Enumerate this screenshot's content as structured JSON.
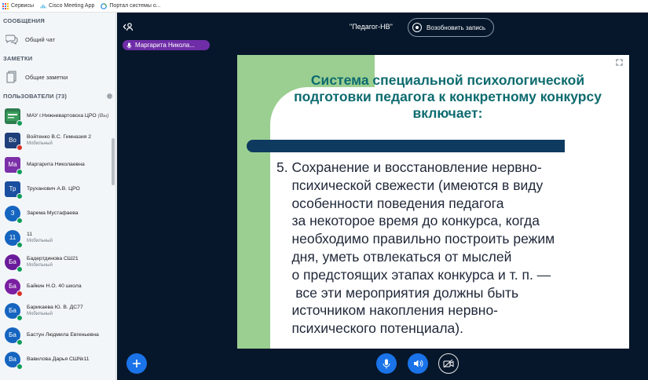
{
  "bookmarks": [
    {
      "label": "Сервисы",
      "icon": "apps-icon"
    },
    {
      "label": "Cisco Meeting App",
      "icon": "cisco-icon"
    },
    {
      "label": "Портал системы о...",
      "icon": "portal-icon"
    }
  ],
  "sidebar": {
    "messages_title": "СООБЩЕНИЯ",
    "public_chat": "Общий чат",
    "notes_title": "ЗАМЕТКИ",
    "shared_notes": "Общие заметки",
    "users_title": "ПОЛЬЗОВАТЕЛИ (73)",
    "users": [
      {
        "initials": "",
        "name": "МАУ г.Нижневартовска ЦРО",
        "you": "(Вы)",
        "sub": "",
        "color": "#2e7d4f",
        "mic": "green",
        "logo": true
      },
      {
        "initials": "Во",
        "name": "Войтенко В.С. Гимназия 2",
        "sub": "Мобильный",
        "color": "#1e3f7a",
        "mic": "red",
        "round": false
      },
      {
        "initials": "Ма",
        "name": "Маргарита Николаевна",
        "sub": "",
        "color": "#7b2fa8",
        "mic": "green",
        "round": false
      },
      {
        "initials": "Тр",
        "name": "Труханович А.В. ЦРО",
        "sub": "",
        "color": "#1a4fa0",
        "mic": "green",
        "round": false
      },
      {
        "initials": "З",
        "name": "Зарема Мустафаева",
        "sub": "",
        "color": "#1565c0",
        "mic": "green",
        "round": true
      },
      {
        "initials": "11",
        "name": "11",
        "sub": "Мобильный",
        "color": "#1565c0",
        "mic": "green",
        "round": true
      },
      {
        "initials": "Ба",
        "name": "Бадертдинова СШ21",
        "sub": "Мобильный",
        "color": "#6a1b9a",
        "mic": "green",
        "round": true
      },
      {
        "initials": "Ба",
        "name": "Байкин Н.О. 40 школа",
        "sub": "",
        "color": "#7b1fa2",
        "mic": "red",
        "round": true
      },
      {
        "initials": "Ба",
        "name": "Барикаева Ю. В. ДС77",
        "sub": "Мобильный",
        "color": "#1565c0",
        "mic": "green",
        "round": true
      },
      {
        "initials": "Ба",
        "name": "Бастун Людмила Евгеньевна",
        "sub": "",
        "color": "#1565c0",
        "mic": "green",
        "round": true
      },
      {
        "initials": "Ва",
        "name": "Вавилова Дарья СШ№11",
        "sub": "",
        "color": "#1565c0",
        "mic": "green",
        "round": true
      }
    ]
  },
  "main": {
    "meeting_title": "\"Педагог-НВ\"",
    "record_label": "Возобновить запись",
    "speaker": "Маргарита Никола...",
    "slide": {
      "title": "Система специальной психологической подготовки педагога к конкретному конкурсу включает:",
      "body": "5. Сохранение и восстановление нервно-\n    психической свежести (имеются в виду\n    особенности поведения педагога\n    за некоторое время до конкурса, когда\n    необходимо правильно построить режим\n    дня, уметь отвлекаться от мыслей\n    о предстоящих этапах конкурса и т. п. —\n     все эти мероприятия должны быть\n    источником накопления нервно-\n    психического потенциала)."
    }
  },
  "colors": {
    "sidebar_bg": "#f3f6f9",
    "main_bg": "#06172b",
    "accent_blue": "#1a73e8",
    "speaker_purple": "#6f2da8",
    "slide_green": "#9bcf91",
    "slide_title": "#0d6b6f",
    "slide_bar": "#0e3a60"
  }
}
